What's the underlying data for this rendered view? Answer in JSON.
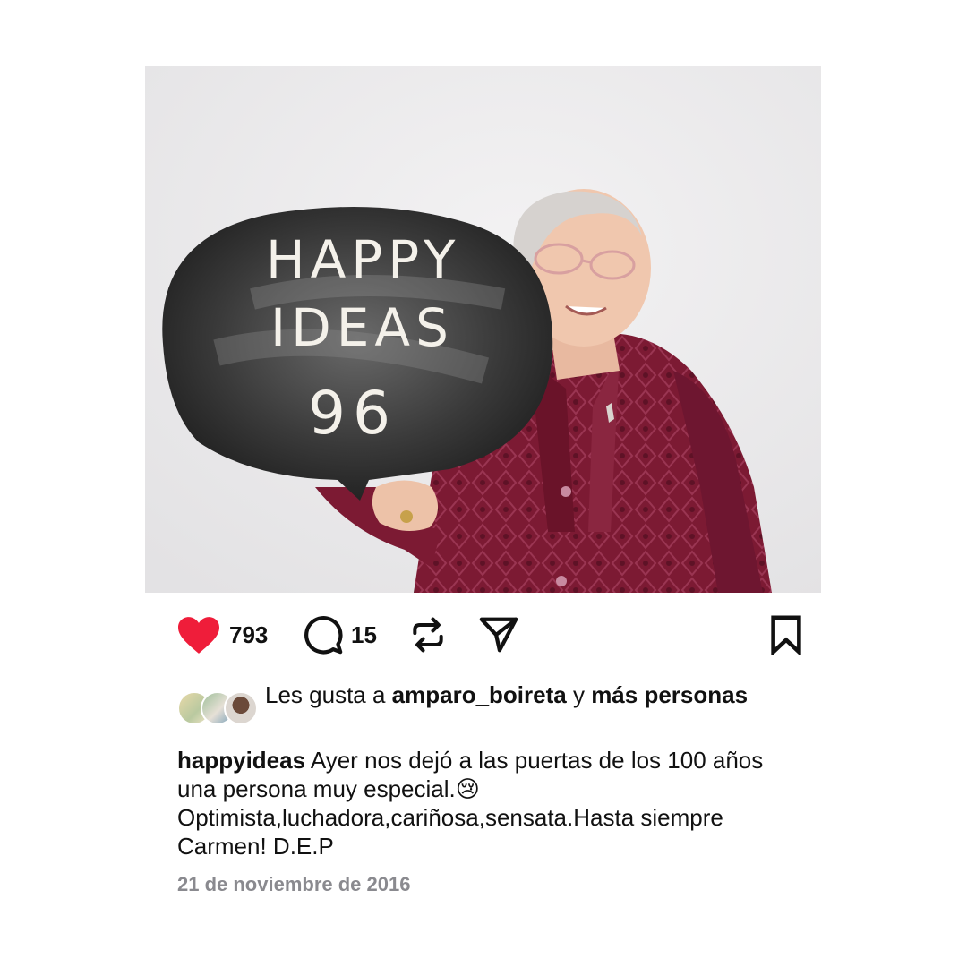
{
  "photo": {
    "board_lines": [
      "HAPPY",
      "IDEAS",
      "96"
    ]
  },
  "actions": {
    "like_count": "793",
    "comment_count": "15",
    "like_color": "#ef1d3a"
  },
  "likes": {
    "prefix": "Les gusta a ",
    "user": "amparo_boireta",
    "connector": " y ",
    "others": "más personas"
  },
  "caption": {
    "username": "happyideas",
    "text": " Ayer nos dejó a las puertas de los 100 años una persona muy especial.😢 Optimista,luchadora,cariñosa,sensata.Hasta siempre Carmen! D.E.P"
  },
  "date": "21 de noviembre de 2016",
  "icons": [
    "heart-icon",
    "comment-icon",
    "repost-icon",
    "share-icon",
    "bookmark-icon"
  ]
}
